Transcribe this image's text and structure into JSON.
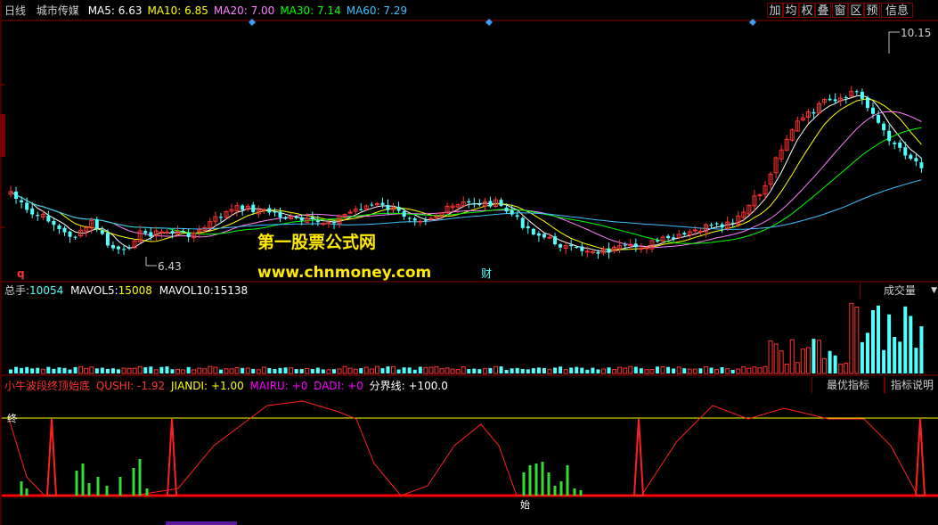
{
  "header": {
    "period": "日线",
    "stock_name": "城市传媒",
    "ma": [
      {
        "label": "MA5:",
        "value": "6.63",
        "color": "#ffffff"
      },
      {
        "label": "MA10:",
        "value": "6.85",
        "color": "#ffff00"
      },
      {
        "label": "MA20:",
        "value": "7.00",
        "color": "#ff80ff"
      },
      {
        "label": "MA30:",
        "value": "7.14",
        "color": "#00ff00"
      },
      {
        "label": "MA60:",
        "value": "7.29",
        "color": "#40c0ff"
      }
    ]
  },
  "toolbar": [
    {
      "label": "加",
      "icon": "add-icon"
    },
    {
      "label": "均",
      "icon": "average-icon"
    },
    {
      "label": "权",
      "icon": "rights-icon"
    },
    {
      "label": "叠",
      "icon": "overlay-icon"
    },
    {
      "label": "窗",
      "icon": "window-icon"
    },
    {
      "label": "区",
      "icon": "range-icon"
    },
    {
      "label": "预",
      "icon": "forecast-icon"
    },
    {
      "label": "信息",
      "icon": "info-icon"
    }
  ],
  "price_panel": {
    "high_label": "10.15",
    "low_label": "6.43",
    "marker_q": "q",
    "marker_cai": "财",
    "watermark_cn": "第一股票公式网",
    "watermark_url": "www.chnmoney.com"
  },
  "volume_panel": {
    "label_total": "总手:",
    "total_value": "10054",
    "label_mavol5": "MAVOL5:",
    "mavol5_value": "15008",
    "label_mavol10": "MAVOL10:",
    "mavol10_value": "15138",
    "dropdown_label": "成交量"
  },
  "indicator_panel": {
    "name": "小牛波段终顶始底",
    "qushi_label": "QUSHI:",
    "qushi_value": "-1.92",
    "jiandi_label": "JIANDI:",
    "jiandi_value": "+1.00",
    "mairu_label": "MAIRU:",
    "mairu_value": "+0",
    "dadi_label": "DADI:",
    "dadi_value": "+0",
    "fenjie_label": "分界线:",
    "fenjie_value": "+100.0",
    "btn_best": "最优指标",
    "btn_explain": "指标说明",
    "tag_end": "终",
    "tag_start": "始"
  },
  "colors": {
    "grid_red": "#8b0000",
    "up": "#ff3232",
    "down": "#54ffff",
    "yellow_line": "#ffff00",
    "magenta": "#ff00ff",
    "green": "#00ff00",
    "sky": "#40c0ff"
  }
}
